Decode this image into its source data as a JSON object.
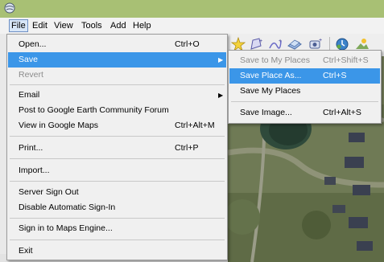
{
  "menubar": {
    "items": [
      "File",
      "Edit",
      "View",
      "Tools",
      "Add",
      "Help"
    ]
  },
  "file_menu": {
    "items": [
      {
        "label": "Open...",
        "shortcut": "Ctrl+O"
      },
      {
        "label": "Save",
        "shortcut": ""
      },
      {
        "label": "Revert",
        "shortcut": ""
      },
      {
        "label": "Email",
        "shortcut": ""
      },
      {
        "label": "Post to Google Earth Community Forum",
        "shortcut": ""
      },
      {
        "label": "View in Google Maps",
        "shortcut": "Ctrl+Alt+M"
      },
      {
        "label": "Print...",
        "shortcut": "Ctrl+P"
      },
      {
        "label": "Import...",
        "shortcut": ""
      },
      {
        "label": "Server Sign Out",
        "shortcut": ""
      },
      {
        "label": "Disable Automatic Sign-In",
        "shortcut": ""
      },
      {
        "label": "Sign in to Maps Engine...",
        "shortcut": ""
      },
      {
        "label": "Exit",
        "shortcut": ""
      }
    ]
  },
  "save_submenu": {
    "items": [
      {
        "label": "Save to My Places",
        "shortcut": "Ctrl+Shift+S"
      },
      {
        "label": "Save Place As...",
        "shortcut": "Ctrl+S"
      },
      {
        "label": "Save My Places",
        "shortcut": ""
      },
      {
        "label": "Save Image...",
        "shortcut": "Ctrl+Alt+S"
      }
    ]
  },
  "icons": {
    "app": "google-earth-app-icon",
    "toolbar": [
      "add-placemark-icon",
      "add-polygon-icon",
      "add-path-icon",
      "add-overlay-icon",
      "record-tour-icon",
      "historical-imagery-icon",
      "sun-icon"
    ]
  },
  "colors": {
    "titlebar": "#a8c074",
    "highlight": "#3b96e8",
    "menu_bg": "#f0f0f0"
  }
}
